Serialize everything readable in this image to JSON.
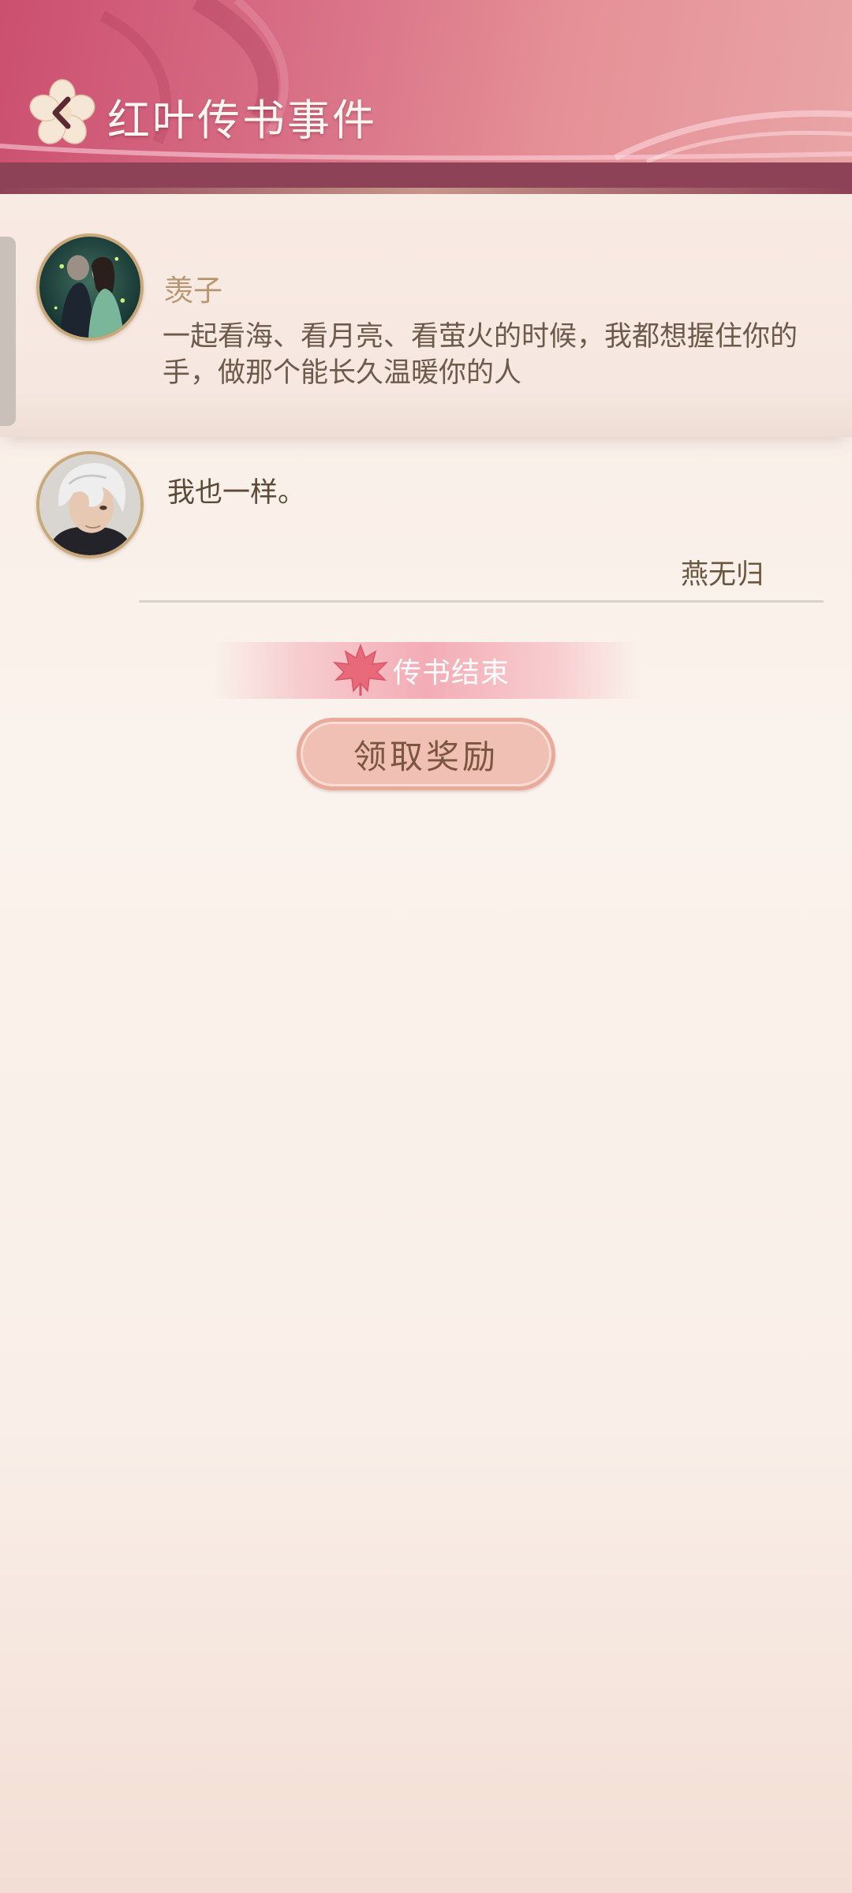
{
  "header": {
    "title": "红叶传书事件",
    "back_icon": "chevron-left-icon"
  },
  "messages": [
    {
      "sender": "羡子",
      "text": "一起看海、看月亮、看萤火的时候，我都想握住你的手，做那个能长久温暖你的人"
    },
    {
      "text": "我也一样。",
      "signature": "燕无归"
    }
  ],
  "end_banner": {
    "label": "传书结束",
    "icon": "maple-leaf-icon"
  },
  "reward_button": {
    "label": "领取奖励"
  },
  "colors": {
    "header": "#d86f86",
    "header_band": "#8e4257",
    "background": "#faf2ec",
    "button": "#f0c0b4",
    "accent_text": "#b89672"
  }
}
